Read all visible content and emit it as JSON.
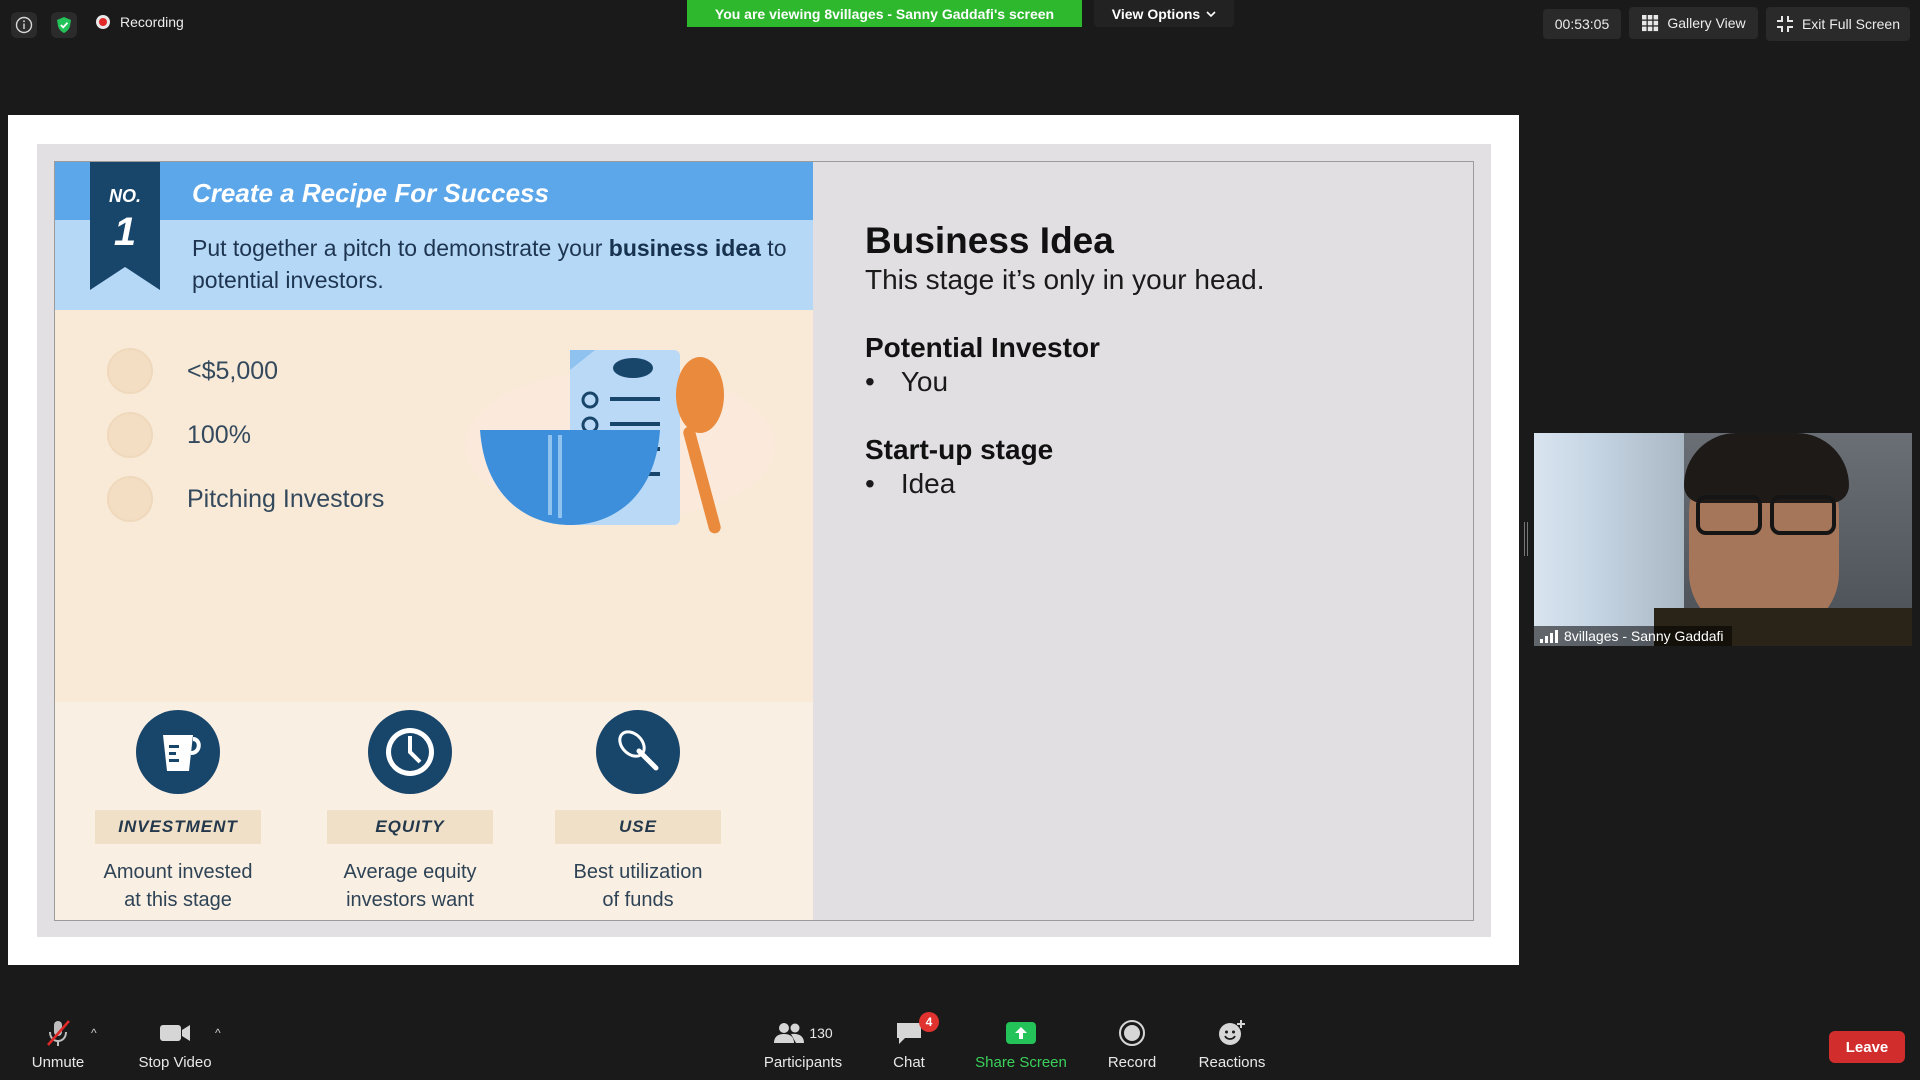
{
  "top_bar": {
    "recording_label": "Recording",
    "viewing_banner": "You are viewing 8villages - Sanny Gaddafi's screen",
    "view_options_label": "View Options",
    "timer": "00:53:05",
    "gallery_view_label": "Gallery View",
    "exit_full_screen_label": "Exit Full Screen",
    "shield_color": "#23c35a",
    "banner_color": "#2db82d"
  },
  "slide": {
    "ribbon_no": "NO.",
    "ribbon_num": "1",
    "title": "Create a Recipe For Success",
    "subtitle_pre": "Put together a pitch to demonstrate your ",
    "subtitle_bold": "business idea",
    "subtitle_post": " to potential investors.",
    "stats": [
      {
        "label": "<$5,000",
        "icon": "cup-icon"
      },
      {
        "label": "100%",
        "icon": "clock-icon"
      },
      {
        "label": "Pitching Investors",
        "icon": "whisk-icon"
      }
    ],
    "features": [
      {
        "tag": "INVESTMENT",
        "desc_line1": "Amount invested",
        "desc_line2": "at this stage",
        "icon": "measuring-cup-icon"
      },
      {
        "tag": "EQUITY",
        "desc_line1": "Average equity",
        "desc_line2": "investors want",
        "icon": "clock-icon"
      },
      {
        "tag": "USE",
        "desc_line1": "Best utilization",
        "desc_line2": "of funds",
        "icon": "whisk-icon"
      }
    ],
    "text_panel": {
      "heading1": "Business Idea",
      "text1": "This stage it’s only in your head.",
      "heading2": "Potential Investor",
      "bullet2": "You",
      "heading3": "Start-up stage",
      "bullet3": "Idea"
    },
    "accent_dark": "#18456a",
    "accent_blue": "#5ca6ea"
  },
  "video": {
    "participant_name": "8villages - Sanny Gaddafi"
  },
  "toolbar": {
    "unmute_label": "Unmute",
    "stop_video_label": "Stop Video",
    "participants_label": "Participants",
    "participants_count": "130",
    "chat_label": "Chat",
    "chat_badge": "4",
    "share_screen_label": "Share Screen",
    "record_label": "Record",
    "reactions_label": "Reactions",
    "leave_label": "Leave",
    "share_color": "#23c35a",
    "leave_color": "#d12d2d"
  }
}
